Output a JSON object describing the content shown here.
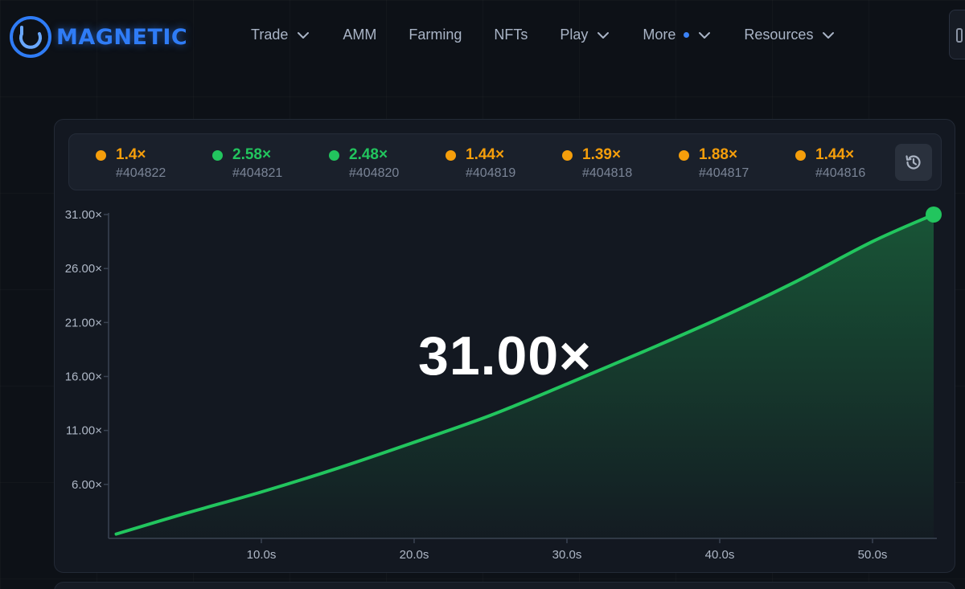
{
  "brand": {
    "name": "MAGNETIC",
    "accent": "#2f7cf6"
  },
  "nav": {
    "items": [
      {
        "label": "Trade",
        "dropdown": true,
        "dot": false
      },
      {
        "label": "AMM",
        "dropdown": false,
        "dot": false
      },
      {
        "label": "Farming",
        "dropdown": false,
        "dot": false
      },
      {
        "label": "NFTs",
        "dropdown": false,
        "dot": false
      },
      {
        "label": "Play",
        "dropdown": true,
        "dot": false
      },
      {
        "label": "More",
        "dropdown": true,
        "dot": true
      },
      {
        "label": "Resources",
        "dropdown": true,
        "dot": false
      }
    ]
  },
  "history": {
    "items": [
      {
        "multiplier": "1.4×",
        "id": "#404822",
        "status": "orange"
      },
      {
        "multiplier": "2.58×",
        "id": "#404821",
        "status": "green"
      },
      {
        "multiplier": "2.48×",
        "id": "#404820",
        "status": "green"
      },
      {
        "multiplier": "1.44×",
        "id": "#404819",
        "status": "orange"
      },
      {
        "multiplier": "1.39×",
        "id": "#404818",
        "status": "orange"
      },
      {
        "multiplier": "1.88×",
        "id": "#404817",
        "status": "orange"
      },
      {
        "multiplier": "1.44×",
        "id": "#404816",
        "status": "orange"
      }
    ],
    "button_icon": "history-icon"
  },
  "colors": {
    "orange": "#f59e0b",
    "green": "#22c55e"
  },
  "current_multiplier": "31.00×",
  "chart_data": {
    "type": "line",
    "title": "",
    "xlabel": "",
    "ylabel": "",
    "x_ticks": [
      "10.0s",
      "20.0s",
      "30.0s",
      "40.0s",
      "50.0s"
    ],
    "x_tick_values": [
      10,
      20,
      30,
      40,
      50
    ],
    "y_ticks": [
      "6.00×",
      "11.00×",
      "16.00×",
      "21.00×",
      "26.00×",
      "31.00×"
    ],
    "y_tick_values": [
      6,
      11,
      16,
      21,
      26,
      31
    ],
    "xlim": [
      0,
      54
    ],
    "ylim": [
      1.0,
      31
    ],
    "series": [
      {
        "x": [
          0.5,
          5,
          10,
          15,
          20,
          25,
          30,
          35,
          40,
          45,
          50,
          54
        ],
        "y": [
          1.4,
          3.3,
          5.3,
          7.5,
          9.9,
          12.4,
          15.3,
          18.3,
          21.4,
          24.8,
          28.5,
          31.0
        ],
        "color": "#22c55e",
        "fill": true
      }
    ],
    "end_marker": true,
    "grid": false
  }
}
